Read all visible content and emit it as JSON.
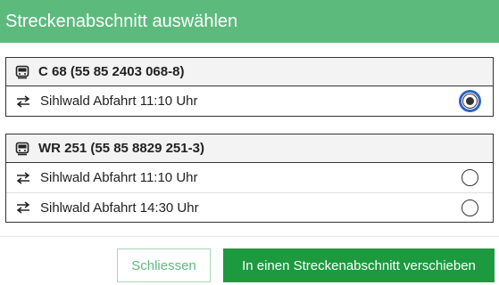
{
  "dialog": {
    "title": "Streckenabschnitt auswählen"
  },
  "groups": [
    {
      "title": "C 68 (55 85 2403 068-8)",
      "icon": "train-icon",
      "rows": [
        {
          "label": "Sihlwald Abfahrt 11:10 Uhr",
          "icon": "swap-arrows-icon",
          "selected": true
        }
      ]
    },
    {
      "title": "WR 251 (55 85 8829 251-3)",
      "icon": "train-icon",
      "rows": [
        {
          "label": "Sihlwald Abfahrt 11:10 Uhr",
          "icon": "swap-arrows-icon",
          "selected": false
        },
        {
          "label": "Sihlwald Abfahrt 14:30 Uhr",
          "icon": "swap-arrows-icon",
          "selected": false
        }
      ]
    }
  ],
  "footer": {
    "cancel_label": "Schliessen",
    "confirm_label": "In einen Streckenabschnitt verschieben"
  },
  "colors": {
    "header_bg": "#5dba7d",
    "primary_button": "#1d9a3f",
    "focus_ring": "#2f63c7"
  }
}
